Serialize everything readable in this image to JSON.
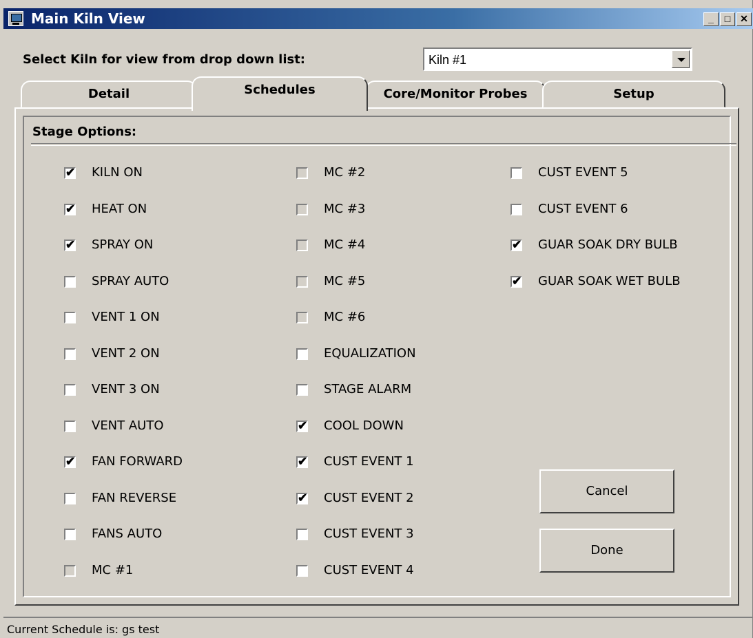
{
  "window": {
    "title": "Main Kiln View",
    "icon": "kiln-app-icon"
  },
  "title_buttons": {
    "minimize": "_",
    "maximize": "□",
    "close": "✕"
  },
  "kiln_select": {
    "label": "Select Kiln for view from drop down list:",
    "value": "Kiln #1"
  },
  "tabs": [
    {
      "label": "Detail",
      "active": false
    },
    {
      "label": "Schedules",
      "active": true
    },
    {
      "label": "Core/Monitor Probes",
      "active": false
    },
    {
      "label": "Setup",
      "active": false
    }
  ],
  "stage_options": {
    "heading": "Stage Options:",
    "columns": [
      [
        {
          "label": "KILN ON",
          "checked": true,
          "enabled": true
        },
        {
          "label": "HEAT ON",
          "checked": true,
          "enabled": true
        },
        {
          "label": "SPRAY ON",
          "checked": true,
          "enabled": true
        },
        {
          "label": "SPRAY AUTO",
          "checked": false,
          "enabled": true
        },
        {
          "label": "VENT 1 ON",
          "checked": false,
          "enabled": true
        },
        {
          "label": "VENT 2 ON",
          "checked": false,
          "enabled": true
        },
        {
          "label": "VENT 3 ON",
          "checked": false,
          "enabled": true
        },
        {
          "label": "VENT AUTO",
          "checked": false,
          "enabled": true
        },
        {
          "label": "FAN FORWARD",
          "checked": true,
          "enabled": true
        },
        {
          "label": "FAN REVERSE",
          "checked": false,
          "enabled": true
        },
        {
          "label": "FANS AUTO",
          "checked": false,
          "enabled": true
        },
        {
          "label": "MC #1",
          "checked": false,
          "enabled": false
        }
      ],
      [
        {
          "label": "MC #2",
          "checked": false,
          "enabled": false
        },
        {
          "label": "MC #3",
          "checked": false,
          "enabled": false
        },
        {
          "label": "MC #4",
          "checked": false,
          "enabled": false
        },
        {
          "label": "MC #5",
          "checked": false,
          "enabled": false
        },
        {
          "label": "MC #6",
          "checked": false,
          "enabled": false
        },
        {
          "label": "EQUALIZATION",
          "checked": false,
          "enabled": true
        },
        {
          "label": "STAGE ALARM",
          "checked": false,
          "enabled": true
        },
        {
          "label": "COOL DOWN",
          "checked": true,
          "enabled": true
        },
        {
          "label": "CUST EVENT 1",
          "checked": true,
          "enabled": true
        },
        {
          "label": "CUST EVENT 2",
          "checked": true,
          "enabled": true
        },
        {
          "label": "CUST EVENT 3",
          "checked": false,
          "enabled": true
        },
        {
          "label": "CUST EVENT 4",
          "checked": false,
          "enabled": true
        }
      ],
      [
        {
          "label": "CUST EVENT 5",
          "checked": false,
          "enabled": true
        },
        {
          "label": "CUST EVENT 6",
          "checked": false,
          "enabled": true
        },
        {
          "label": "GUAR SOAK DRY BULB",
          "checked": true,
          "enabled": true
        },
        {
          "label": "GUAR SOAK WET BULB",
          "checked": true,
          "enabled": true
        }
      ]
    ]
  },
  "buttons": {
    "cancel": "Cancel",
    "done": "Done"
  },
  "status": {
    "text": "Current Schedule is: gs test"
  }
}
